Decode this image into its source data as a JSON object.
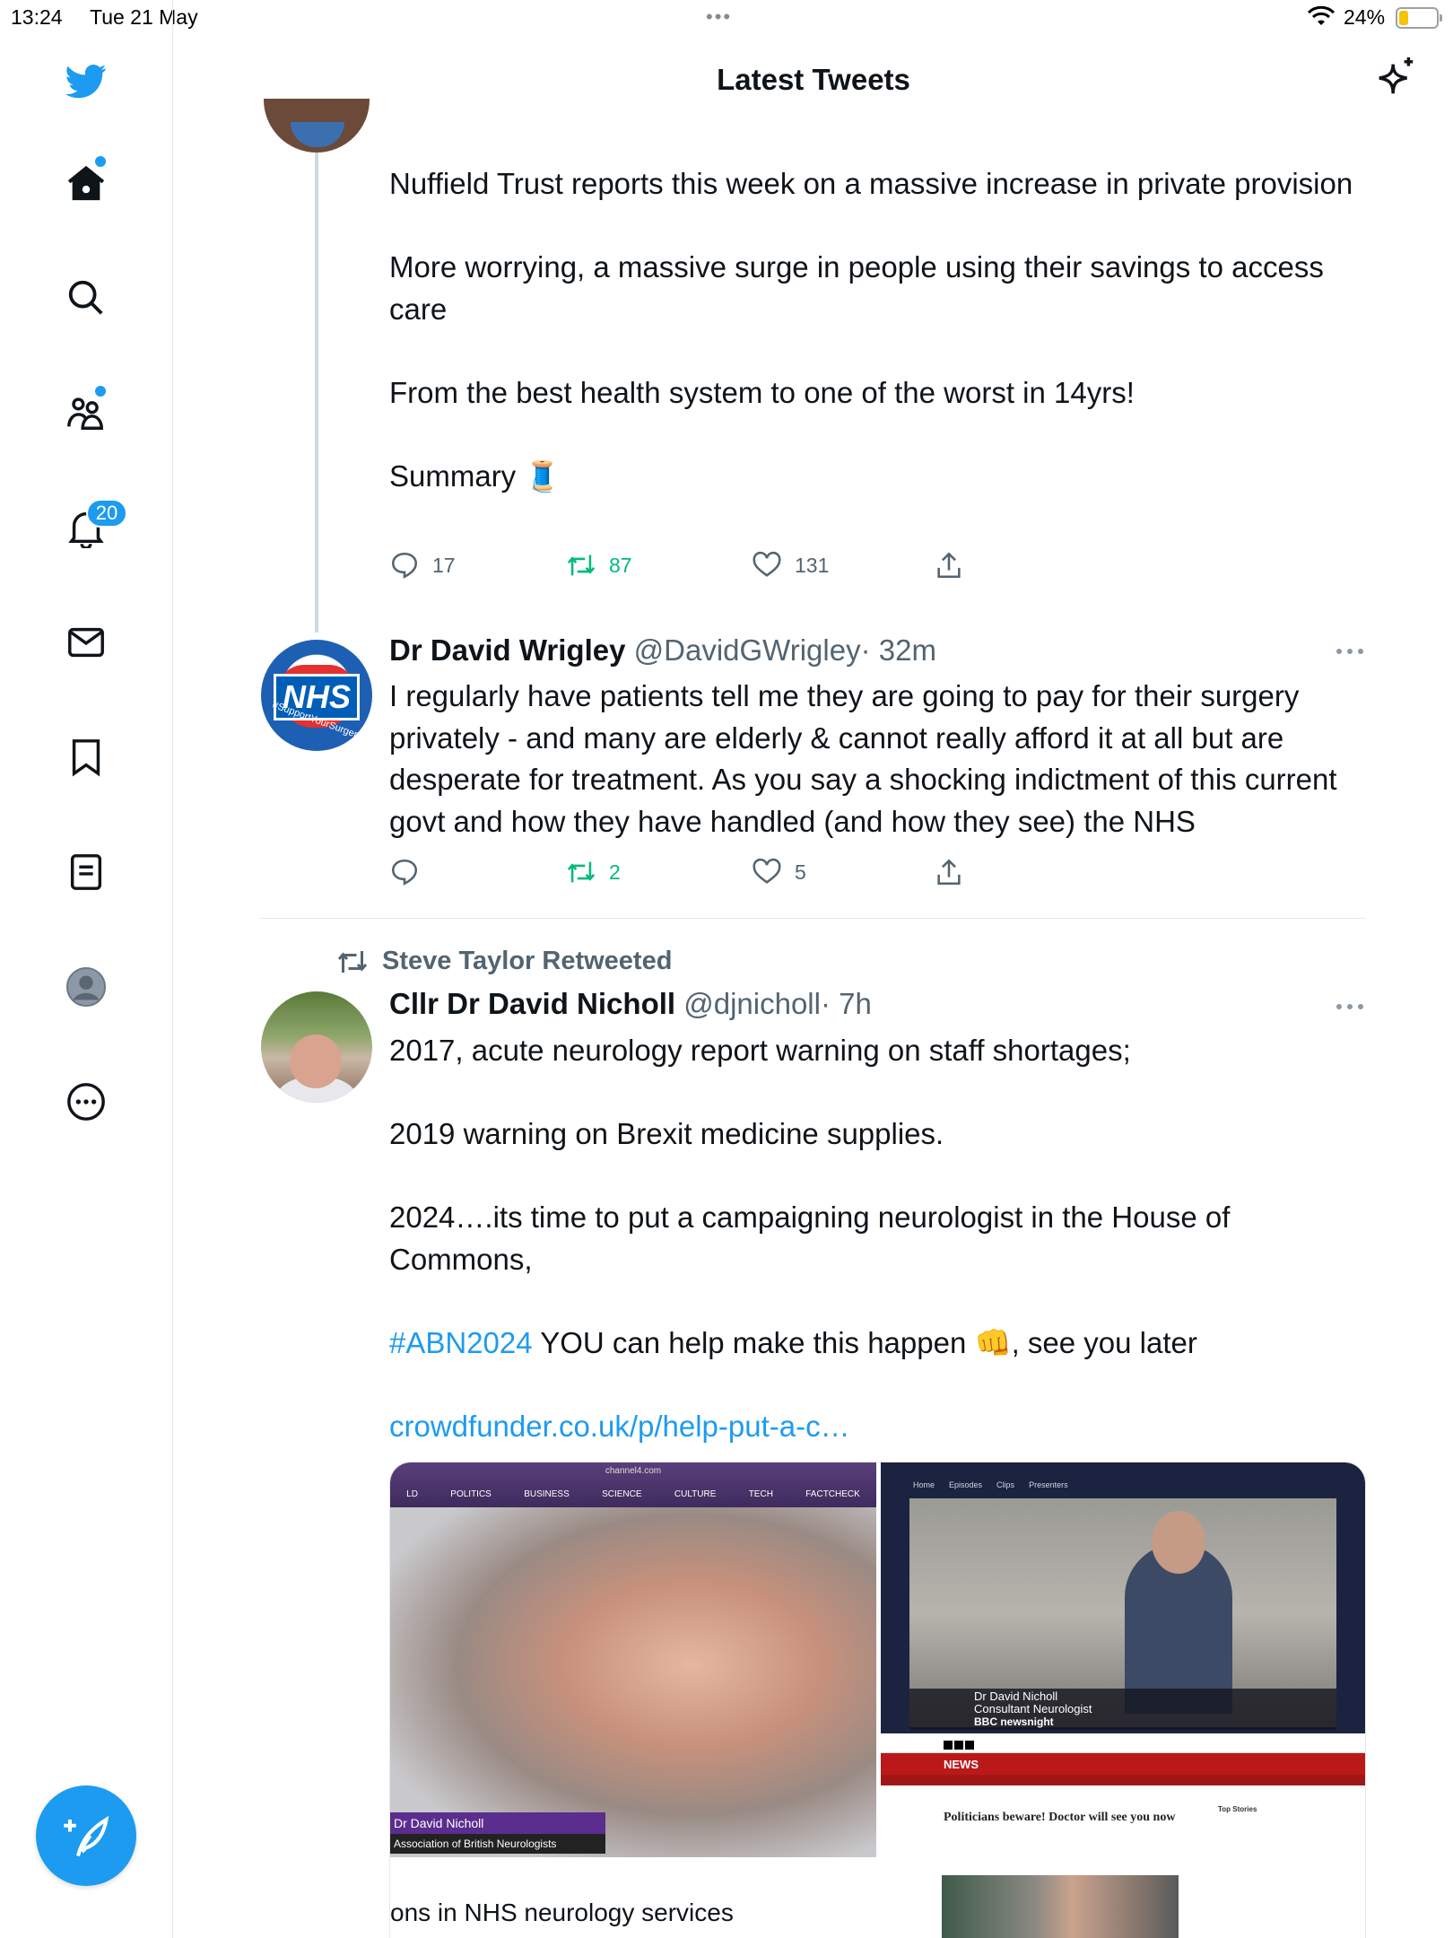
{
  "status_bar": {
    "time": "13:24",
    "date": "Tue 21 May",
    "battery_percent": "24%",
    "battery_level": 0.24
  },
  "sidebar": {
    "items": [
      {
        "name": "twitter-bird-icon"
      },
      {
        "name": "home-icon",
        "has_dot": true
      },
      {
        "name": "search-icon"
      },
      {
        "name": "communities-icon",
        "has_dot": true
      },
      {
        "name": "notifications-icon",
        "badge": "20"
      },
      {
        "name": "messages-icon"
      },
      {
        "name": "bookmarks-icon"
      },
      {
        "name": "lists-icon"
      },
      {
        "name": "profile-icon"
      },
      {
        "name": "more-icon"
      }
    ],
    "compose_icon": "compose-icon"
  },
  "header": {
    "title": "Latest Tweets",
    "sparkle_icon": "sparkle-icon"
  },
  "tweets": [
    {
      "paragraphs": [
        "Nuffield Trust reports this week on a massive increase in private provision",
        "More worrying, a massive surge in people using their savings to access care",
        "From the best health system to one of the worst in 14yrs!",
        "Summary 🧵"
      ],
      "replies": "17",
      "retweets": "87",
      "likes": "131"
    },
    {
      "name": "Dr David Wrigley",
      "handle": "@DavidGWrigley",
      "time": "· 32m",
      "avatar_text": "NHS",
      "avatar_ring": "#SupportYourSurgery",
      "body": "I regularly have patients tell me they are going to pay for their surgery privately - and many are elderly & cannot really afford it at all but are desperate for treatment. As you say a shocking indictment of this current govt and how they have handled (and how they see) the NHS",
      "replies": "",
      "retweets": "2",
      "likes": "5"
    },
    {
      "retweeted_by": "Steve Taylor Retweeted",
      "name": "Cllr Dr David Nicholl",
      "handle": "@djnicholl",
      "time": "· 7h",
      "paragraphs": [
        "2017, acute neurology report warning on staff shortages;",
        "2019 warning on Brexit medicine supplies.",
        "2024….its time to put a campaigning neurologist in the House of Commons,"
      ],
      "hashtag": "#ABN2024",
      "hashtag_rest": " YOU can help make this happen 👊, see you later",
      "link": "crowdfunder.co.uk/p/help-put-a-c…",
      "media": {
        "ch4_url": "channel4.com",
        "ch4_nav": [
          "LD",
          "POLITICS",
          "BUSINESS",
          "SCIENCE",
          "CULTURE",
          "TECH",
          "FACTCHECK"
        ],
        "ch4_caption_name": "Dr David Nicholl",
        "ch4_caption_org": "Association of British Neurologists",
        "ch4_subtitle": "ons in NHS neurology services",
        "nn_nav": [
          "Home",
          "Episodes",
          "Clips",
          "Presenters"
        ],
        "nn_caption_name": "Dr David Nicholl",
        "nn_caption_role": "Consultant Neurologist",
        "nn_brand": "BBC newsnight",
        "bbc_section": "NEWS",
        "bbc_headline": "Politicians beware! Doctor will see you now",
        "bbc_side_title": "Top Stories"
      }
    }
  ]
}
